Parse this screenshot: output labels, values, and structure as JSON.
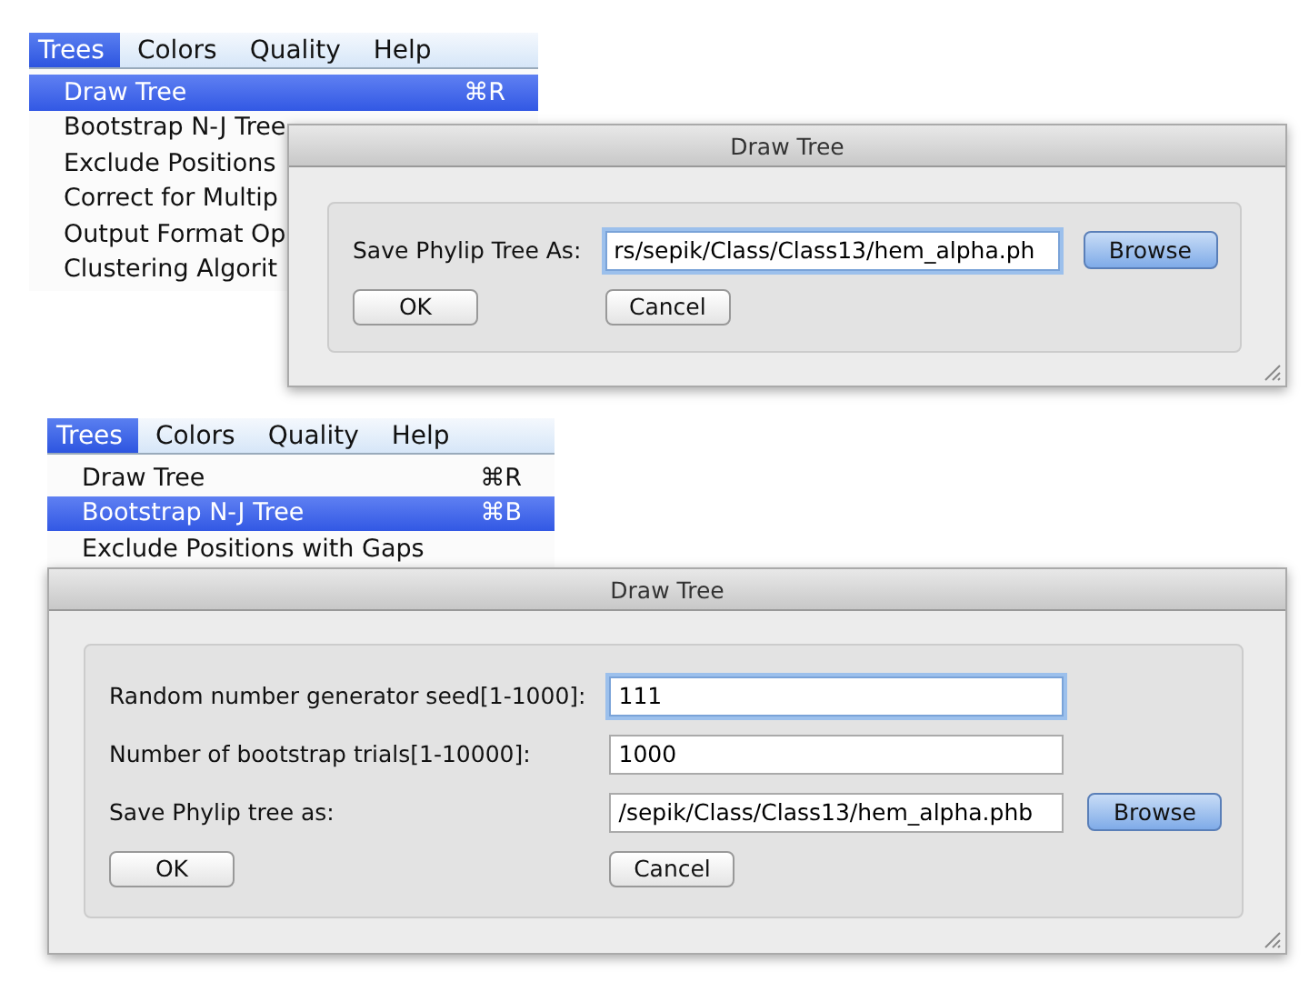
{
  "scenes": [
    {
      "menubar": [
        {
          "label": "Trees",
          "selected": true
        },
        {
          "label": "Colors",
          "selected": false
        },
        {
          "label": "Quality",
          "selected": false
        },
        {
          "label": "Help",
          "selected": false
        }
      ],
      "menu_items": [
        {
          "label": "Draw Tree",
          "shortcut": "⌘R",
          "selected": true
        },
        {
          "label": "Bootstrap N-J Tree",
          "selected": false
        },
        {
          "label": "Exclude Positions",
          "selected": false
        },
        {
          "label": "Correct for Multip",
          "selected": false
        },
        {
          "label": "Output Format Op",
          "selected": false
        },
        {
          "label": "Clustering Algorit",
          "selected": false
        }
      ],
      "dialog": {
        "title": "Draw Tree",
        "fields": [
          {
            "label": "Save Phylip Tree As:",
            "value": "rs/sepik/Class/Class13/hem_alpha.ph",
            "focused": true,
            "button": "Browse"
          }
        ],
        "buttons": [
          "OK",
          "Cancel"
        ]
      }
    },
    {
      "menubar": [
        {
          "label": "Trees",
          "selected": true
        },
        {
          "label": "Colors",
          "selected": false
        },
        {
          "label": "Quality",
          "selected": false
        },
        {
          "label": "Help",
          "selected": false
        }
      ],
      "menu_items": [
        {
          "label": "Draw Tree",
          "shortcut": "⌘R",
          "selected": false
        },
        {
          "label": "Bootstrap N-J Tree",
          "shortcut": "⌘B",
          "selected": true
        },
        {
          "label": "Exclude Positions with Gaps",
          "selected": false
        }
      ],
      "dialog": {
        "title": "Draw Tree",
        "fields": [
          {
            "label": "Random number generator seed[1-1000]:",
            "value": "111",
            "focused": true
          },
          {
            "label": "Number of bootstrap trials[1-10000]:",
            "value": "1000",
            "focused": false
          },
          {
            "label": "Save Phylip tree as:",
            "value": "/sepik/Class/Class13/hem_alpha.phb",
            "focused": false,
            "button": "Browse"
          }
        ],
        "buttons": [
          "OK",
          "Cancel"
        ]
      }
    }
  ]
}
